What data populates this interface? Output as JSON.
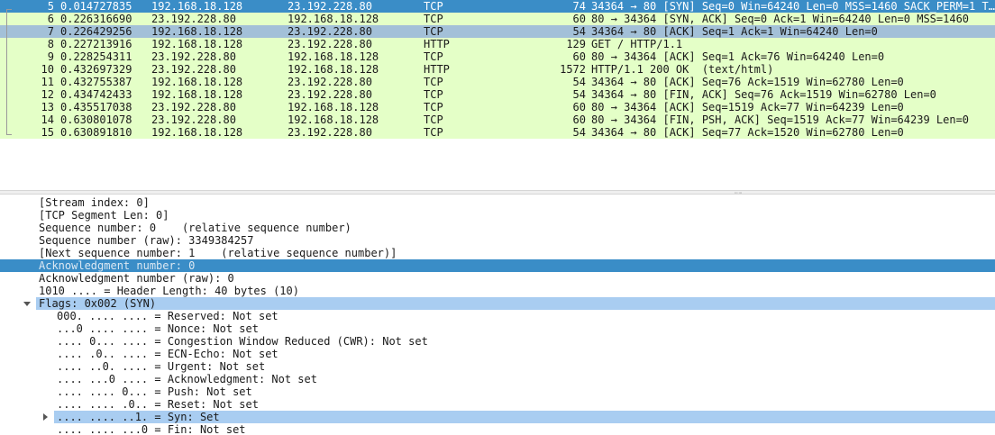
{
  "colors": {
    "tcp_row": "#e4ffc7",
    "http_row": "#e4ffc7",
    "selected_row": "#3a8dc7",
    "related_row": "#a3c0d8",
    "selected_field": "#3a8dc7",
    "highlighted_field": "#a9cdf1"
  },
  "packets": [
    {
      "no": "5",
      "time": "0.014727835",
      "src": "192.168.18.128",
      "dst": "23.192.228.80",
      "proto": "TCP",
      "len": "74",
      "info": "34364 → 80 [SYN] Seq=0 Win=64240 Len=0 MSS=1460 SACK_PERM=1 T…",
      "state": "selected"
    },
    {
      "no": "6",
      "time": "0.226316690",
      "src": "23.192.228.80",
      "dst": "192.168.18.128",
      "proto": "TCP",
      "len": "60",
      "info": "80 → 34364 [SYN, ACK] Seq=0 Ack=1 Win=64240 Len=0 MSS=1460",
      "state": "normal"
    },
    {
      "no": "7",
      "time": "0.226429256",
      "src": "192.168.18.128",
      "dst": "23.192.228.80",
      "proto": "TCP",
      "len": "54",
      "info": "34364 → 80 [ACK] Seq=1 Ack=1 Win=64240 Len=0",
      "state": "related"
    },
    {
      "no": "8",
      "time": "0.227213916",
      "src": "192.168.18.128",
      "dst": "23.192.228.80",
      "proto": "HTTP",
      "len": "129",
      "info": "GET / HTTP/1.1",
      "state": "normal"
    },
    {
      "no": "9",
      "time": "0.228254311",
      "src": "23.192.228.80",
      "dst": "192.168.18.128",
      "proto": "TCP",
      "len": "60",
      "info": "80 → 34364 [ACK] Seq=1 Ack=76 Win=64240 Len=0",
      "state": "normal"
    },
    {
      "no": "10",
      "time": "0.432697329",
      "src": "23.192.228.80",
      "dst": "192.168.18.128",
      "proto": "HTTP",
      "len": "1572",
      "info": "HTTP/1.1 200 OK  (text/html)",
      "state": "normal"
    },
    {
      "no": "11",
      "time": "0.432755387",
      "src": "192.168.18.128",
      "dst": "23.192.228.80",
      "proto": "TCP",
      "len": "54",
      "info": "34364 → 80 [ACK] Seq=76 Ack=1519 Win=62780 Len=0",
      "state": "normal"
    },
    {
      "no": "12",
      "time": "0.434742433",
      "src": "192.168.18.128",
      "dst": "23.192.228.80",
      "proto": "TCP",
      "len": "54",
      "info": "34364 → 80 [FIN, ACK] Seq=76 Ack=1519 Win=62780 Len=0",
      "state": "normal"
    },
    {
      "no": "13",
      "time": "0.435517038",
      "src": "23.192.228.80",
      "dst": "192.168.18.128",
      "proto": "TCP",
      "len": "60",
      "info": "80 → 34364 [ACK] Seq=1519 Ack=77 Win=64239 Len=0",
      "state": "normal"
    },
    {
      "no": "14",
      "time": "0.630801078",
      "src": "23.192.228.80",
      "dst": "192.168.18.128",
      "proto": "TCP",
      "len": "60",
      "info": "80 → 34364 [FIN, PSH, ACK] Seq=1519 Ack=77 Win=64239 Len=0",
      "state": "normal"
    },
    {
      "no": "15",
      "time": "0.630891810",
      "src": "192.168.18.128",
      "dst": "23.192.228.80",
      "proto": "TCP",
      "len": "54",
      "info": "34364 → 80 [ACK] Seq=77 Ack=1520 Win=62780 Len=0",
      "state": "normal"
    }
  ],
  "details": [
    {
      "text": "[Stream index: 0]",
      "level": 0,
      "state": "normal",
      "expander": "none"
    },
    {
      "text": "[TCP Segment Len: 0]",
      "level": 0,
      "state": "normal",
      "expander": "none"
    },
    {
      "text": "Sequence number: 0    (relative sequence number)",
      "level": 0,
      "state": "normal",
      "expander": "none"
    },
    {
      "text": "Sequence number (raw): 3349384257",
      "level": 0,
      "state": "normal",
      "expander": "none"
    },
    {
      "text": "[Next sequence number: 1    (relative sequence number)]",
      "level": 0,
      "state": "normal",
      "expander": "none"
    },
    {
      "text": "Acknowledgment number: 0",
      "level": 0,
      "state": "selected",
      "expander": "none"
    },
    {
      "text": "Acknowledgment number (raw): 0",
      "level": 0,
      "state": "normal",
      "expander": "none"
    },
    {
      "text": "1010 .... = Header Length: 40 bytes (10)",
      "level": 0,
      "state": "normal",
      "expander": "none"
    },
    {
      "text": "Flags: 0x002 (SYN)",
      "level": 0,
      "state": "highlight",
      "expander": "expanded"
    },
    {
      "text": "000. .... .... = Reserved: Not set",
      "level": 1,
      "state": "normal",
      "expander": "none"
    },
    {
      "text": "...0 .... .... = Nonce: Not set",
      "level": 1,
      "state": "normal",
      "expander": "none"
    },
    {
      "text": ".... 0... .... = Congestion Window Reduced (CWR): Not set",
      "level": 1,
      "state": "normal",
      "expander": "none"
    },
    {
      "text": ".... .0.. .... = ECN-Echo: Not set",
      "level": 1,
      "state": "normal",
      "expander": "none"
    },
    {
      "text": ".... ..0. .... = Urgent: Not set",
      "level": 1,
      "state": "normal",
      "expander": "none"
    },
    {
      "text": ".... ...0 .... = Acknowledgment: Not set",
      "level": 1,
      "state": "normal",
      "expander": "none"
    },
    {
      "text": ".... .... 0... = Push: Not set",
      "level": 1,
      "state": "normal",
      "expander": "none"
    },
    {
      "text": ".... .... .0.. = Reset: Not set",
      "level": 1,
      "state": "normal",
      "expander": "none"
    },
    {
      "text": ".... .... ..1. = Syn: Set",
      "level": 1,
      "state": "highlight",
      "expander": "collapsed"
    },
    {
      "text": ".... .... ...0 = Fin: Not set",
      "level": 1,
      "state": "normal",
      "expander": "none"
    }
  ]
}
